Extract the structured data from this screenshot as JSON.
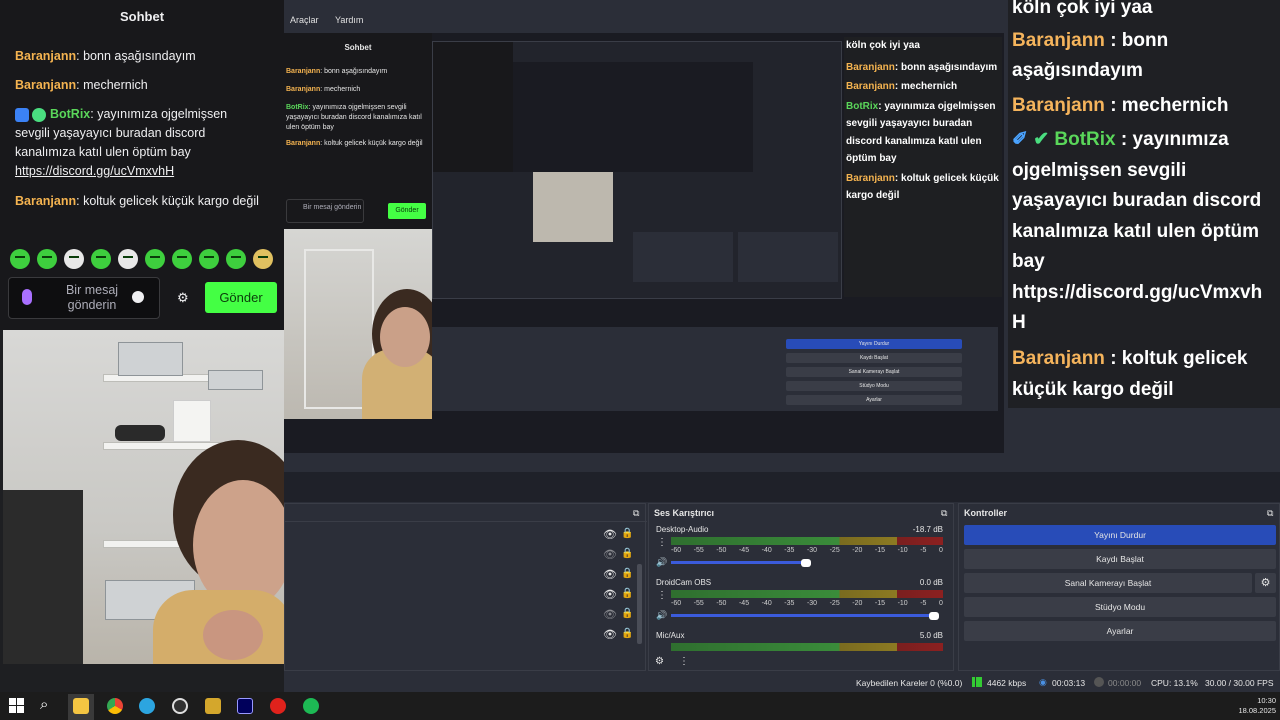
{
  "chat": {
    "title": "Sohbet",
    "messages": [
      {
        "user": "Baranjann",
        "text": ": bonn aşağısındayım"
      },
      {
        "user": "Baranjann",
        "text": ": mechernich"
      },
      {
        "user": "BotRix",
        "text": ": yayınımıza ojgelmişsen sevgili yaşayayıcı buradan discord kanalımıza katıl ulen öptüm bay",
        "link": "https://discord.gg/ucVmxvhH"
      },
      {
        "user": "Baranjann",
        "text": ": koltuk gelicek küçük kargo değil"
      }
    ],
    "input_placeholder": "Bir mesaj gönderin",
    "send_label": "Gönder"
  },
  "obs": {
    "menu": [
      "Araçlar",
      "Yardım"
    ],
    "mixer": {
      "title": "Ses Karıştırıcı",
      "tracks": [
        {
          "name": "Desktop-Audio",
          "db": "-18.7 dB"
        },
        {
          "name": "DroidCam OBS",
          "db": "0.0 dB"
        },
        {
          "name": "Mic/Aux",
          "db": "5.0 dB"
        }
      ],
      "ticks": [
        "-60",
        "-55",
        "-50",
        "-45",
        "-40",
        "-35",
        "-30",
        "-25",
        "-20",
        "-15",
        "-10",
        "-5",
        "0"
      ]
    },
    "controls": {
      "title": "Kontroller",
      "buttons": [
        "Yayını Durdur",
        "Kaydı Başlat",
        "Sanal Kamerayı Başlat",
        "Stüdyo Modu",
        "Ayarlar"
      ]
    },
    "status": {
      "dropped": "Kaybedilen Kareler 0 (%0.0)",
      "bitrate": "4462 kbps",
      "stream_time": "00:03:13",
      "rec_time": "00:00:00",
      "cpu": "CPU: 13.1%",
      "fps": "30.00 / 30.00 FPS"
    }
  },
  "overlay": {
    "top_text": "köln çok iyi yaa"
  },
  "taskbar": {
    "time": "10:30",
    "date": "18.08.2025"
  }
}
